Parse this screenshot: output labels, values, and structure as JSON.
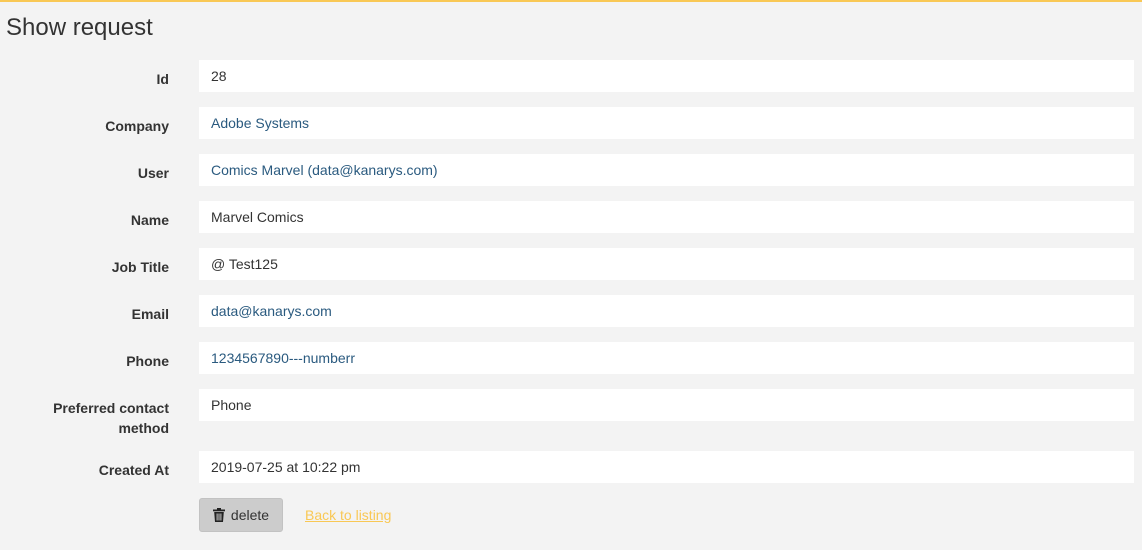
{
  "page": {
    "title": "Show request"
  },
  "fields": {
    "id": {
      "label": "Id",
      "value": "28"
    },
    "company": {
      "label": "Company",
      "value": "Adobe Systems"
    },
    "user": {
      "label": "User",
      "value": "Comics Marvel (data@kanarys.com)"
    },
    "name": {
      "label": "Name",
      "value": "Marvel Comics"
    },
    "job_title": {
      "label": "Job Title",
      "value": "@ Test125"
    },
    "email": {
      "label": "Email",
      "value": "data@kanarys.com"
    },
    "phone": {
      "label": "Phone",
      "value": "1234567890---numberr"
    },
    "preferred_contact": {
      "label_line1": "Preferred contact",
      "label_line2": "method",
      "value": "Phone"
    },
    "created_at": {
      "label": "Created At",
      "value": "2019-07-25 at 10:22 pm"
    }
  },
  "actions": {
    "delete_label": "delete",
    "delete_icon": "trash-icon",
    "back_label": "Back to listing"
  },
  "colors": {
    "accent": "#f9c855",
    "link": "#2a5a7f",
    "background": "#f3f3f3",
    "button": "#cccccc"
  }
}
